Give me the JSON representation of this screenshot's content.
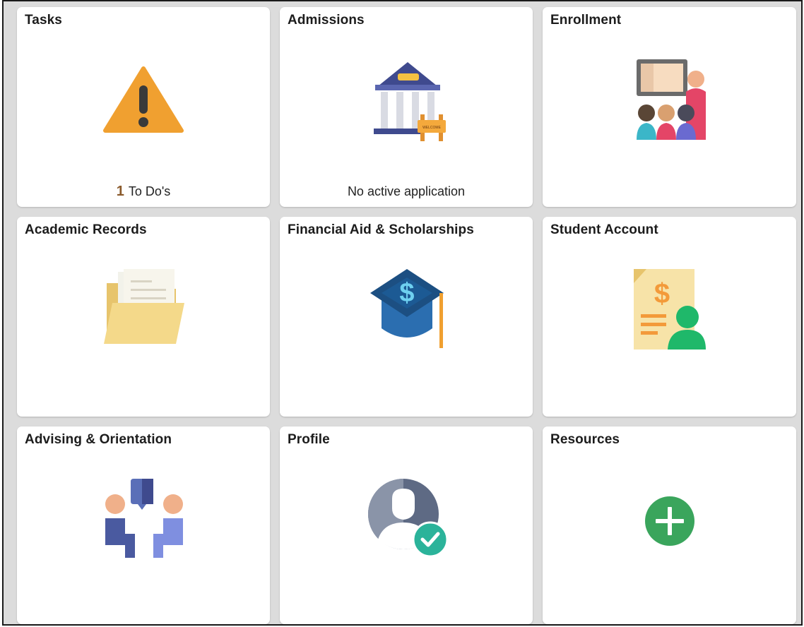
{
  "tiles": [
    {
      "title": "Tasks",
      "icon": "warning-icon",
      "count": "1",
      "footer": "To Do's"
    },
    {
      "title": "Admissions",
      "icon": "university-building-icon",
      "sign": "WELCOME",
      "footer": "No active application"
    },
    {
      "title": "Enrollment",
      "icon": "classroom-icon"
    },
    {
      "title": "Academic Records",
      "icon": "folder-documents-icon"
    },
    {
      "title": "Financial Aid & Scholarships",
      "icon": "graduation-cap-dollar-icon",
      "symbol": "$"
    },
    {
      "title": "Student Account",
      "icon": "invoice-user-icon",
      "symbol": "$"
    },
    {
      "title": "Advising & Orientation",
      "icon": "conversation-people-icon"
    },
    {
      "title": "Profile",
      "icon": "user-profile-check-icon"
    },
    {
      "title": "Resources",
      "icon": "plus-circle-icon"
    }
  ],
  "colors": {
    "warning": "#f0a030",
    "cap_dark": "#1c4f82",
    "cap_light": "#2b6eb0",
    "green": "#1fb86a",
    "plus_green": "#3aa55c",
    "folder": "#f4d98a"
  }
}
